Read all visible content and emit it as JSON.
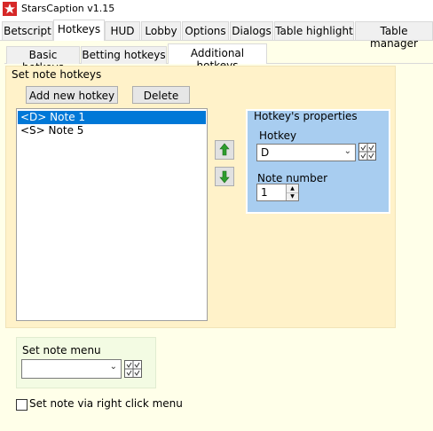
{
  "window": {
    "title": "StarsCaption v1.15",
    "icon": "app-logo-icon"
  },
  "tabs": [
    {
      "label": "Betscript"
    },
    {
      "label": "Hotkeys",
      "active": true
    },
    {
      "label": "HUD"
    },
    {
      "label": "Lobby"
    },
    {
      "label": "Options"
    },
    {
      "label": "Dialogs"
    },
    {
      "label": "Table highlight"
    },
    {
      "label": "Table manager"
    }
  ],
  "subtabs": [
    {
      "label": "Basic hotkeys"
    },
    {
      "label": "Betting hotkeys"
    },
    {
      "label": "Additional hotkeys",
      "active": true
    }
  ],
  "set_note_hotkeys": {
    "title": "Set note hotkeys",
    "add_button": "Add new hotkey",
    "delete_button": "Delete",
    "list": [
      {
        "text": "<D> Note 1",
        "selected": true
      },
      {
        "text": "<S> Note 5",
        "selected": false
      }
    ],
    "move_up_icon": "arrow-up-icon",
    "move_down_icon": "arrow-down-icon",
    "properties": {
      "title": "Hotkey's properties",
      "hotkey_label": "Hotkey",
      "hotkey_value": "D",
      "note_number_label": "Note number",
      "note_number_value": "1"
    }
  },
  "set_note_menu": {
    "label": "Set note menu",
    "value": ""
  },
  "right_click": {
    "label": "Set note via right click menu",
    "checked": false
  },
  "colors": {
    "content_bg": "#ffffe9",
    "group_bg": "#fff2c9",
    "props_bg": "#a8cdf0",
    "menu_group_bg": "#f3fbe3",
    "selection": "#0078d7",
    "arrow_green": "#2e9e2e"
  }
}
